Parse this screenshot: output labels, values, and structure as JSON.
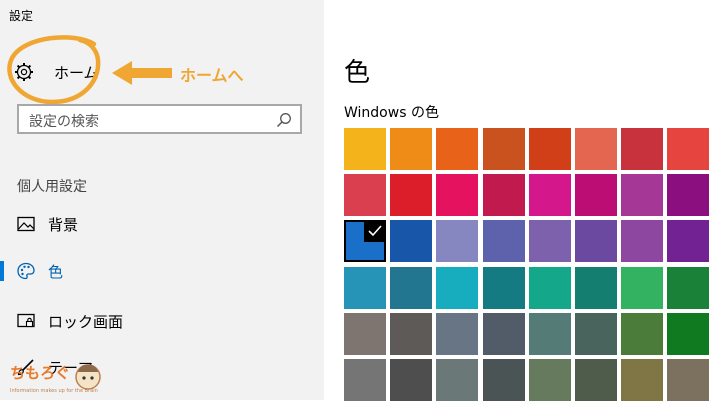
{
  "window": {
    "title": "設定"
  },
  "sidebar": {
    "home_label": "ホーム",
    "search_placeholder": "設定の検索",
    "section_label": "個人用設定",
    "items": [
      {
        "label": "背景",
        "icon": "image-icon",
        "active": false
      },
      {
        "label": "色",
        "icon": "palette-icon",
        "active": true
      },
      {
        "label": "ロック画面",
        "icon": "lock-screen-icon",
        "active": false
      },
      {
        "label": "テーマ",
        "icon": "brush-icon",
        "active": false
      }
    ]
  },
  "annotation": {
    "text": "ホームへ",
    "color": "#f0a632"
  },
  "main": {
    "title": "色",
    "subtitle": "Windows の色",
    "colors": [
      [
        "#f4b21b",
        "#ef8c18",
        "#e86319",
        "#c9521f",
        "#d13f19",
        "#e56650",
        "#c8323d",
        "#e5443f"
      ],
      [
        "#da3f50",
        "#db1e29",
        "#e5125f",
        "#c11a4e",
        "#d4178a",
        "#bb0d74",
        "#a53897",
        "#8c0f80"
      ],
      [
        "#1a70c8",
        "#1756a8",
        "#8686c0",
        "#5e62ad",
        "#7d61ad",
        "#6b49a0",
        "#8e47a0",
        "#722292"
      ],
      [
        "#2694b6",
        "#23768f",
        "#17acbe",
        "#157b83",
        "#14a78a",
        "#147f71",
        "#33b262",
        "#1a8238"
      ],
      [
        "#7e7570",
        "#5d5a57",
        "#677585",
        "#525c69",
        "#557b77",
        "#48645c",
        "#4c7c3a",
        "#0f7a20"
      ],
      [
        "#757575",
        "#4e4e4e",
        "#6a7977",
        "#4b5454",
        "#667a5e",
        "#4f5c4c",
        "#807544",
        "#7c715f"
      ]
    ],
    "selected": {
      "row": 2,
      "col": 0
    }
  },
  "watermark": {
    "text": "ちもろぐ",
    "sub": "Information makes up for the Brain"
  }
}
